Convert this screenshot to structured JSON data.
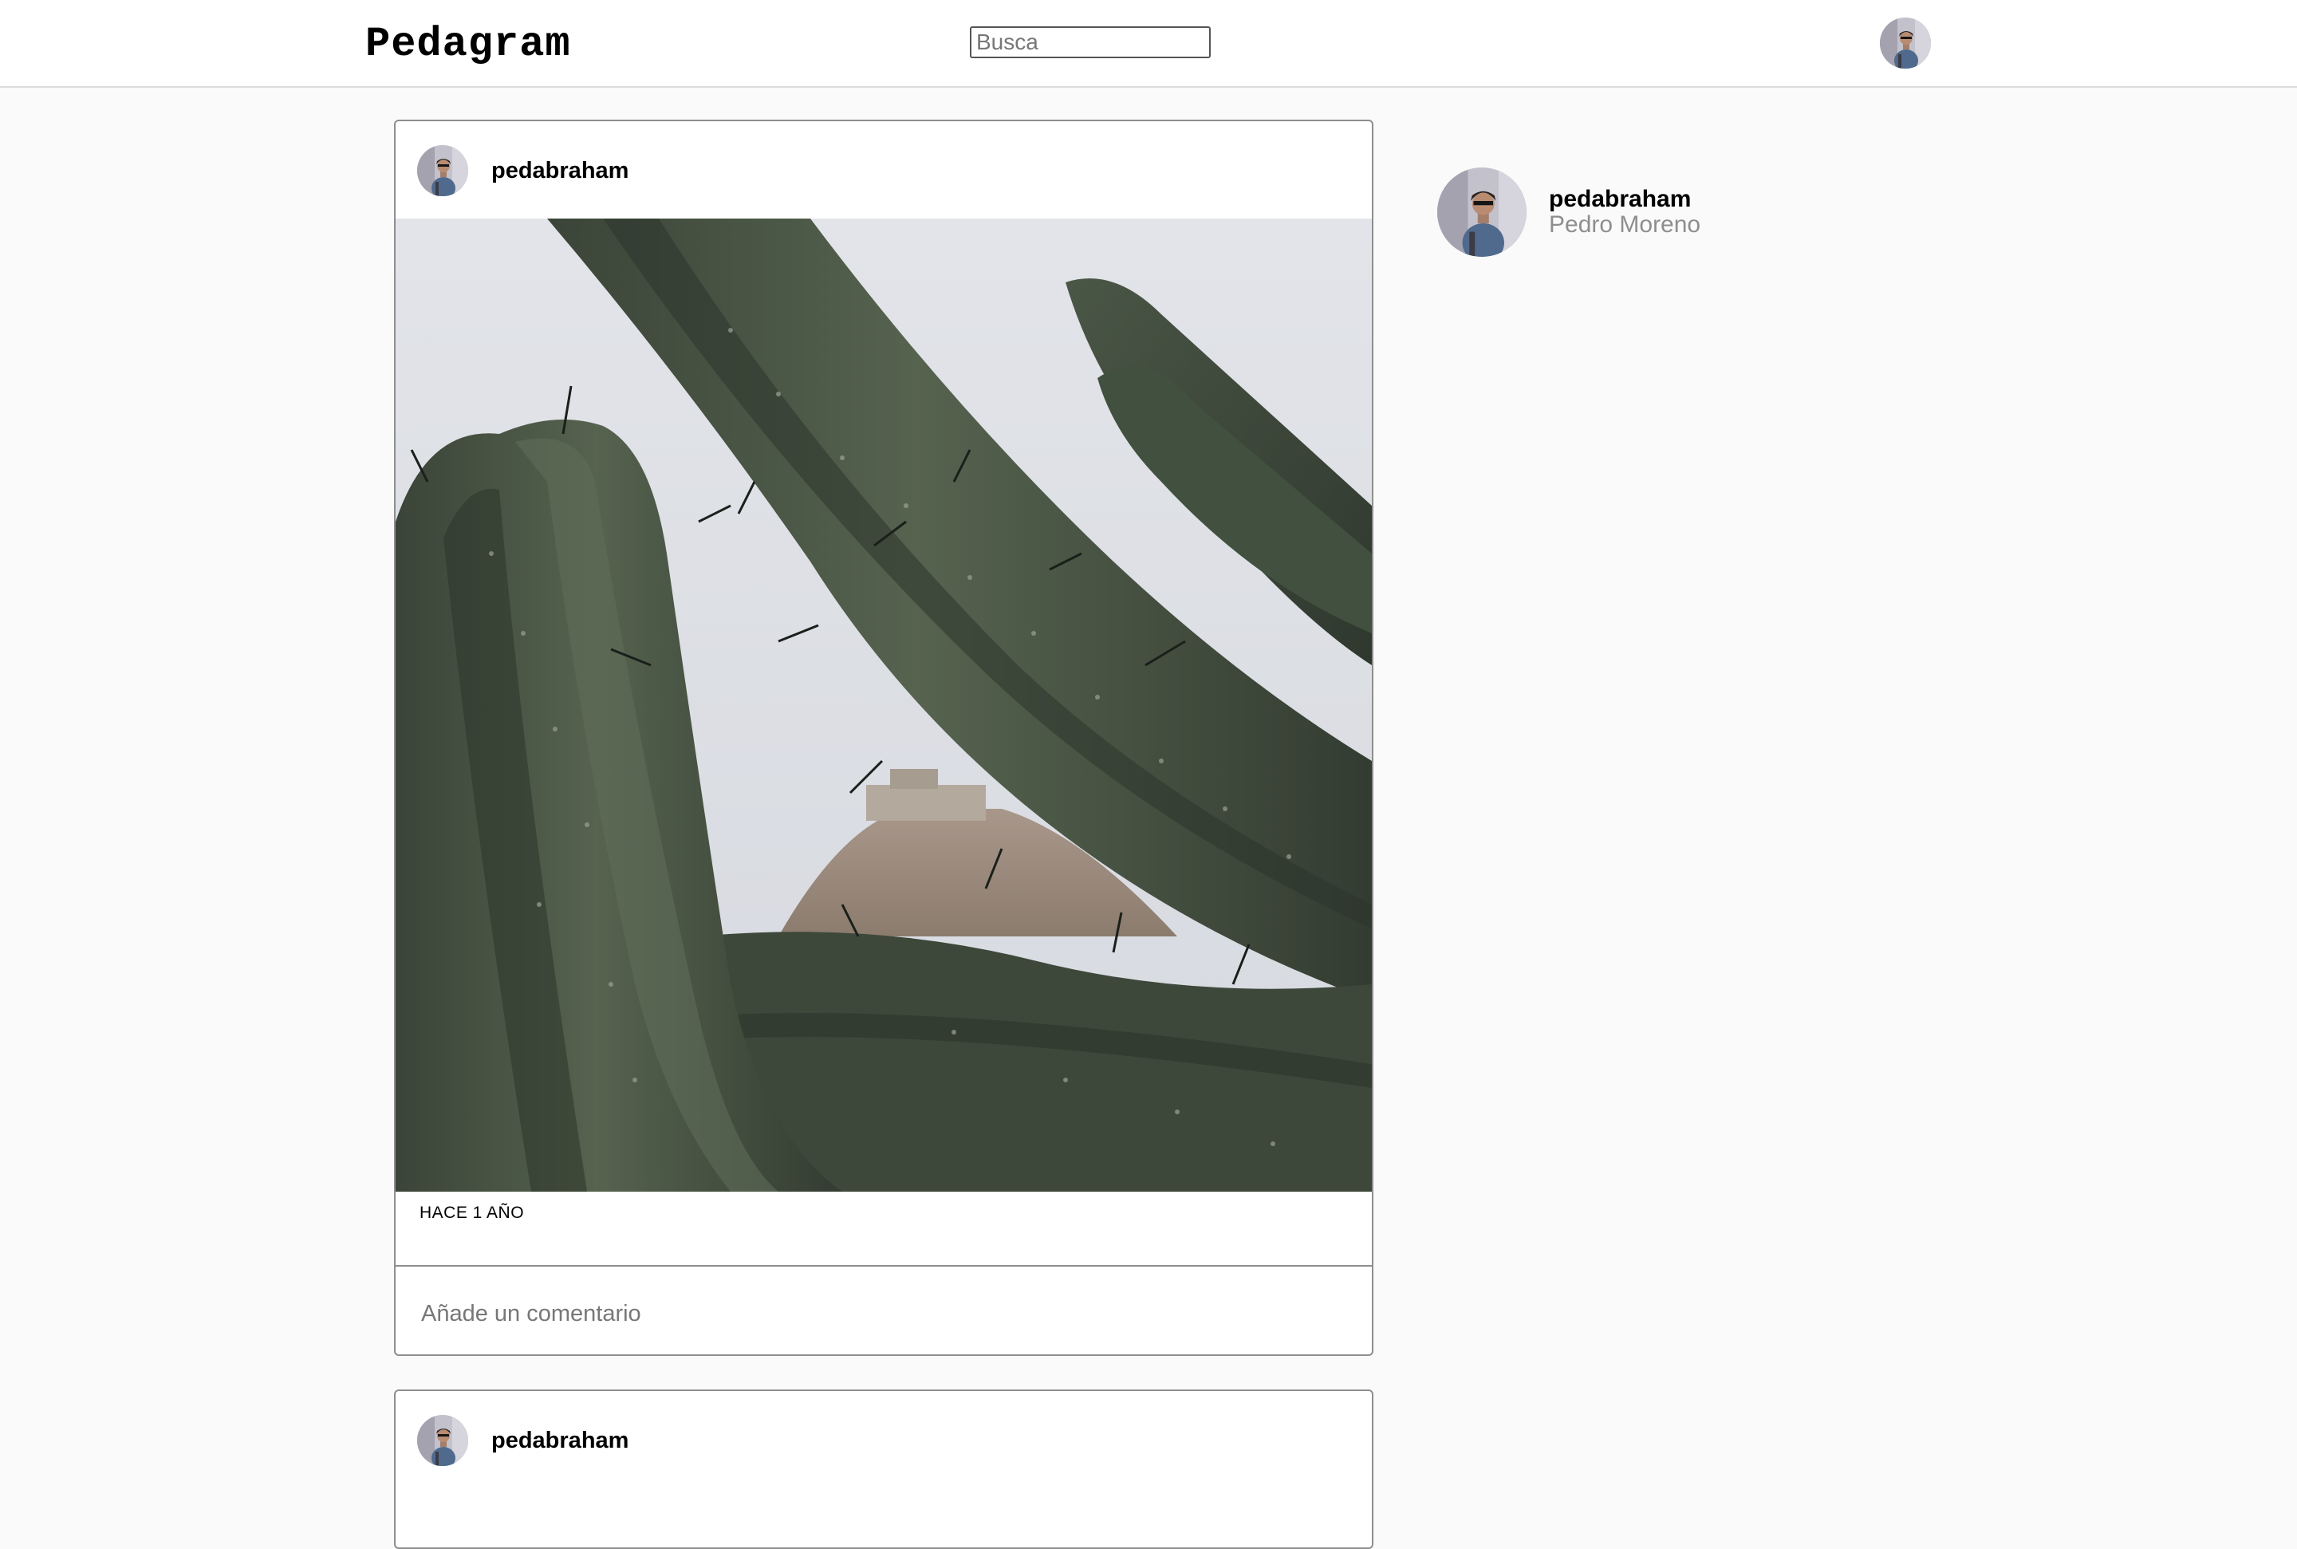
{
  "header": {
    "logo": "Pedagram",
    "search_placeholder": "Busca"
  },
  "post": {
    "username": "pedabraham",
    "timestamp": "HACE 1 AÑO",
    "comment_placeholder": "Añade un comentario"
  },
  "next_post": {
    "username": "pedabraham"
  },
  "sidebar": {
    "username": "pedabraham",
    "full_name": "Pedro Moreno"
  },
  "colors": {
    "background": "#fafafa",
    "border": "#8e8e8e",
    "secondary_text": "#8e8e8e"
  }
}
